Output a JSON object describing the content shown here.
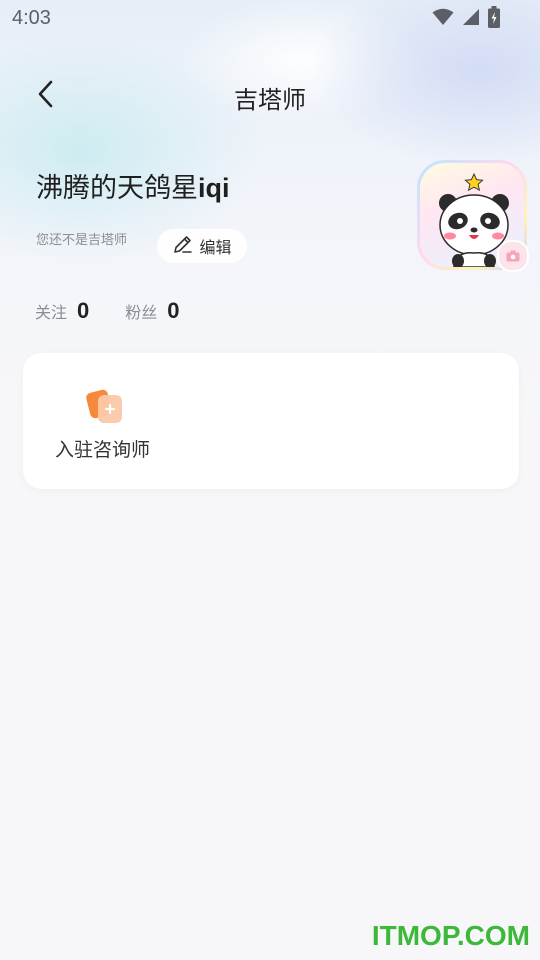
{
  "status_bar": {
    "time": "4:03",
    "icons": [
      "wifi-icon",
      "cellular-signal-icon",
      "battery-charging-icon"
    ]
  },
  "nav": {
    "back_icon": "chevron-left-icon",
    "title": "吉塔师"
  },
  "profile": {
    "nickname_cjk": "沸腾的天鸽星",
    "nickname_latin": "iqi",
    "not_tarot_text": "您还不是吉塔师",
    "edit_label": "编辑",
    "edit_icon": "pencil-icon",
    "avatar": "panda-avatar",
    "camera_icon": "camera-icon"
  },
  "stats": [
    {
      "label": "关注",
      "value": "0"
    },
    {
      "label": "粉丝",
      "value": "0"
    }
  ],
  "entries": [
    {
      "label": "入驻咨询师",
      "icon": "consultant-apply-icon"
    }
  ],
  "colors": {
    "accent_orange": "#f7893f",
    "watermark_green": "#3cb83a"
  },
  "watermark": "ITMOP.COM"
}
